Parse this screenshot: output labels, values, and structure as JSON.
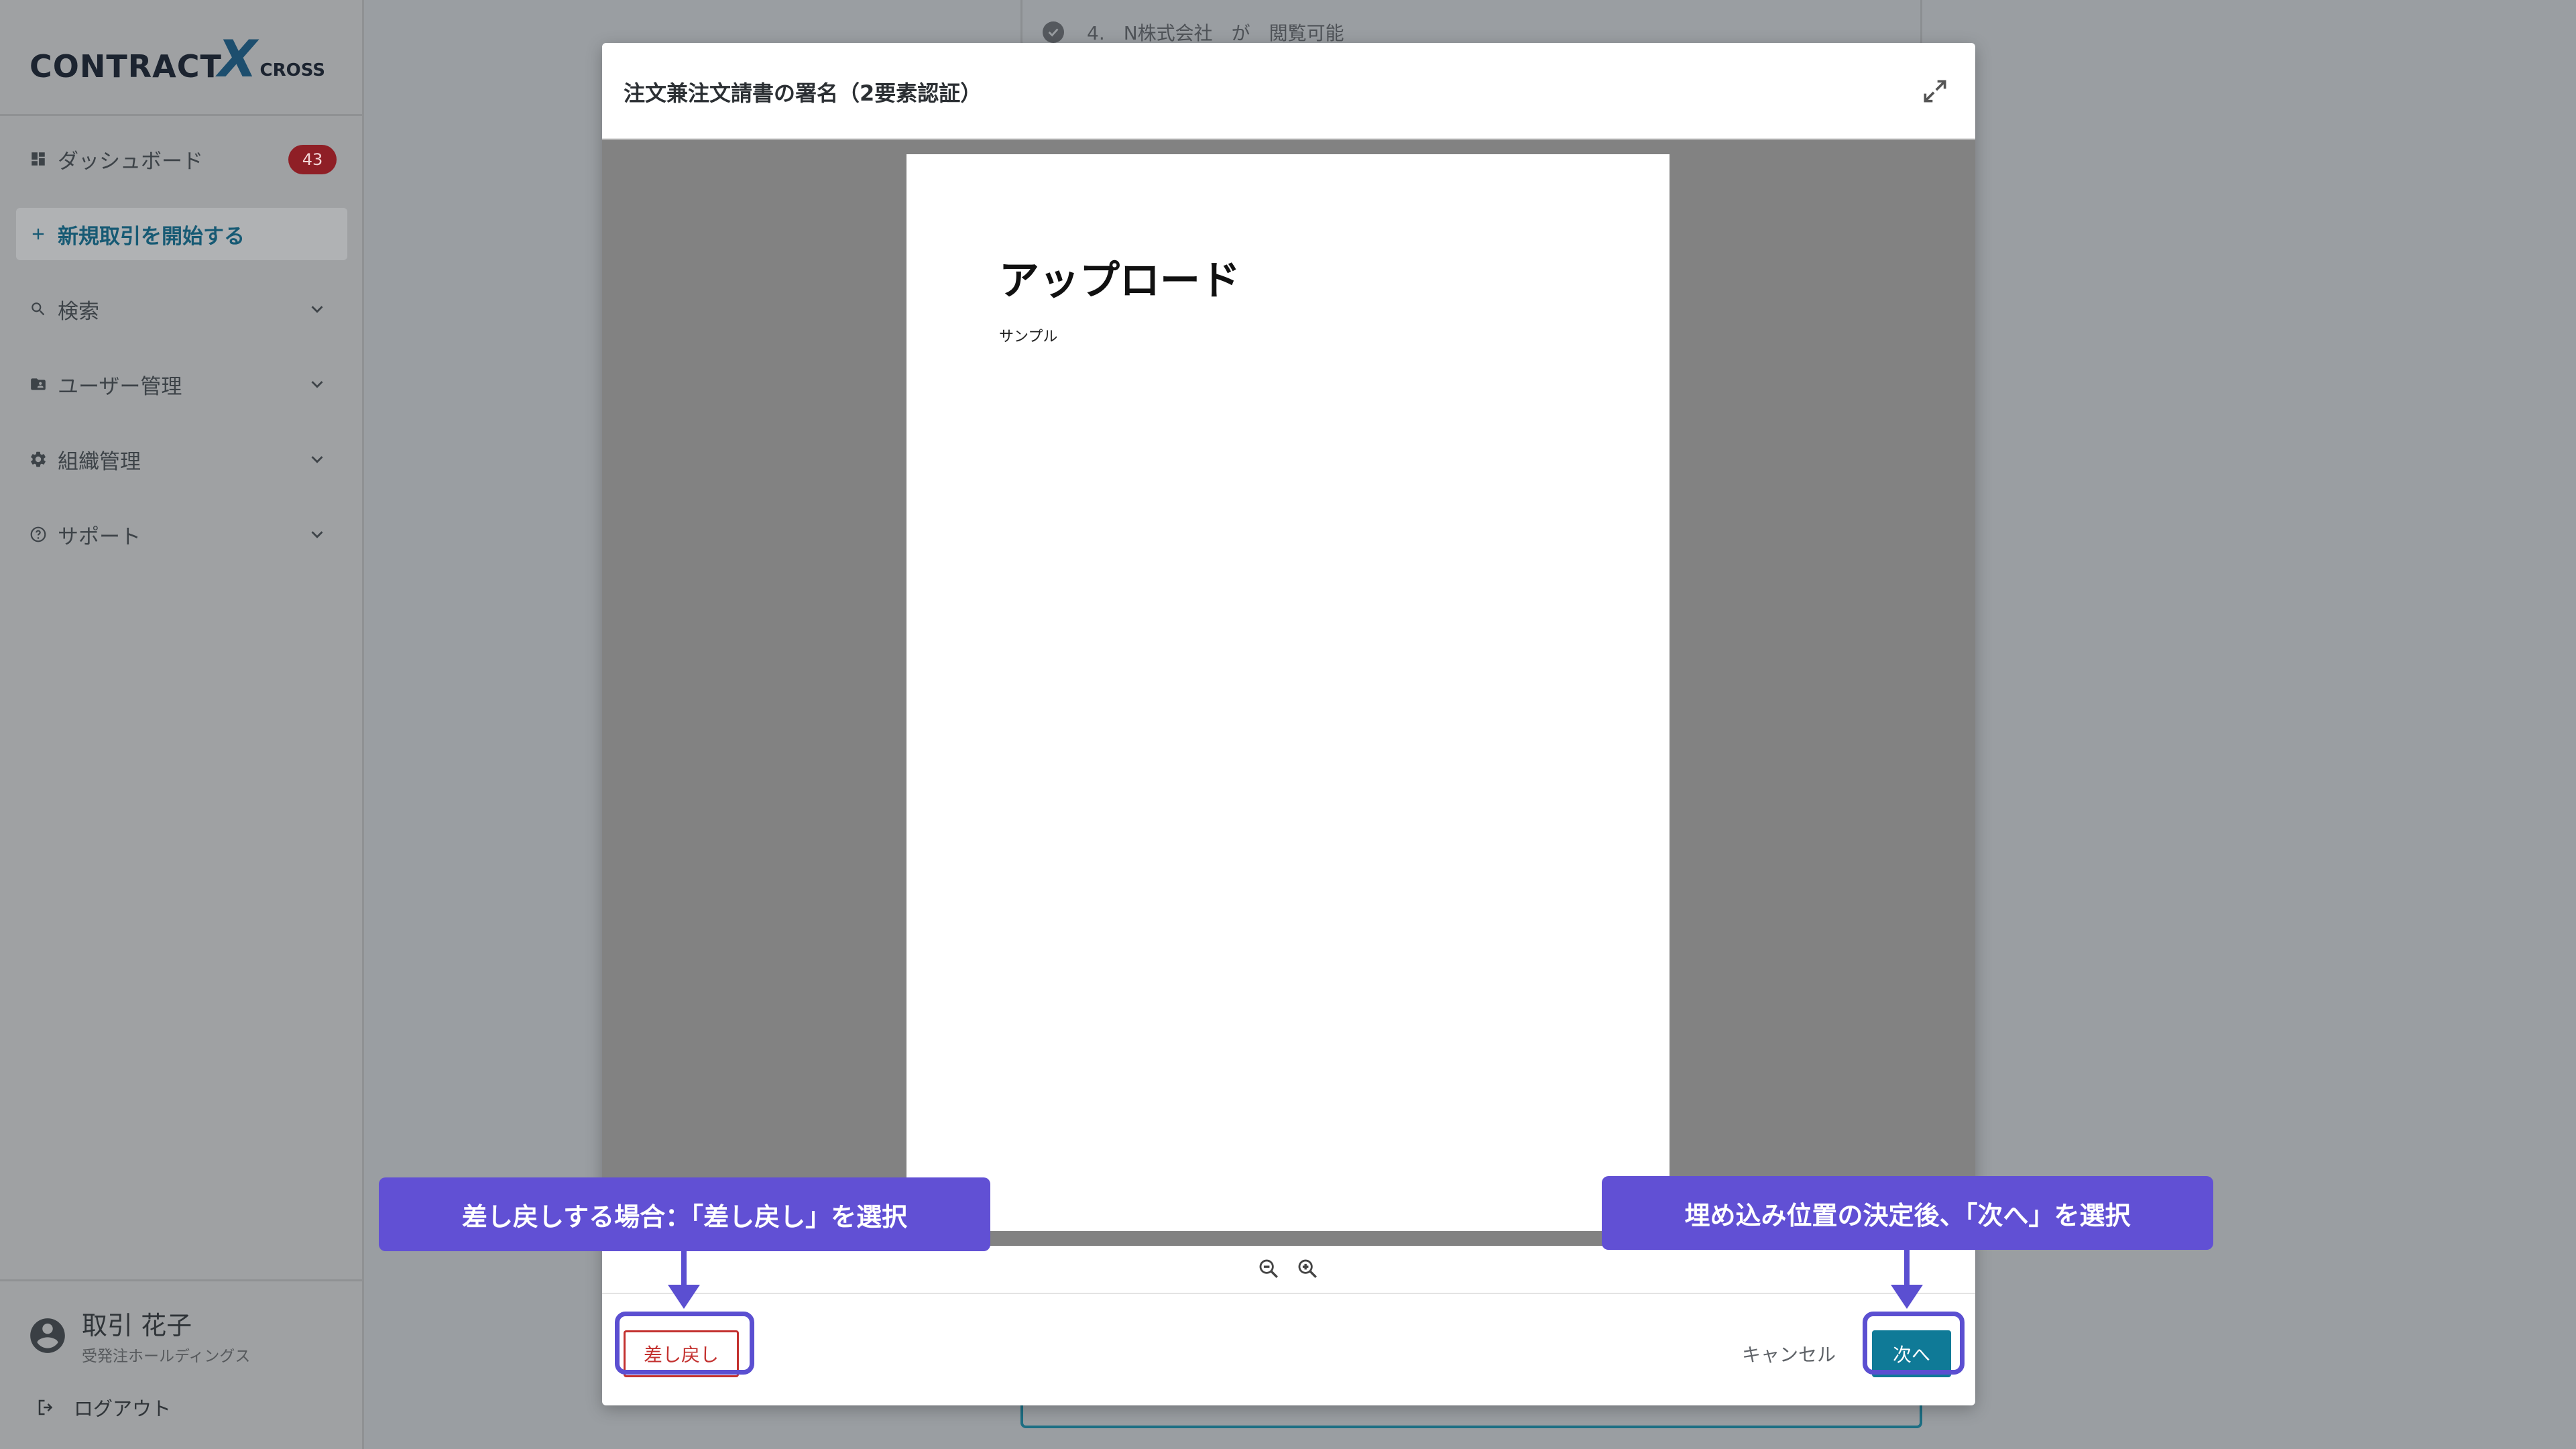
{
  "app": {
    "logo_main": "CONTRACT",
    "logo_x": "X",
    "logo_sub": "CROSS"
  },
  "sidebar": {
    "dashboard": {
      "label": "ダッシュボード",
      "badge": "43"
    },
    "new_deal": {
      "label": "新規取引を開始する"
    },
    "items": [
      {
        "label": "検索"
      },
      {
        "label": "ユーザー管理"
      },
      {
        "label": "組織管理"
      },
      {
        "label": "サポート"
      }
    ],
    "user": {
      "name": "取引 花子",
      "org": "受発注ホールディングス"
    },
    "logout": "ログアウト"
  },
  "background": {
    "step_text": "4.　N株式会社　が　閲覧可能"
  },
  "modal": {
    "title": "注文兼注文請書の署名（2要素認証）",
    "document": {
      "heading": "アップロード",
      "body": "サンプル"
    },
    "buttons": {
      "return": "差し戻し",
      "cancel": "キャンセル",
      "next": "次へ"
    }
  },
  "annotations": {
    "left": "差し戻しする場合：「差し戻し」を選択",
    "right": "埋め込み位置の決定後、「次へ」を選択"
  },
  "colors": {
    "accent": "#0f7a97",
    "danger": "#c3312f",
    "callout": "#6150d4",
    "badge": "#8f1f26"
  }
}
